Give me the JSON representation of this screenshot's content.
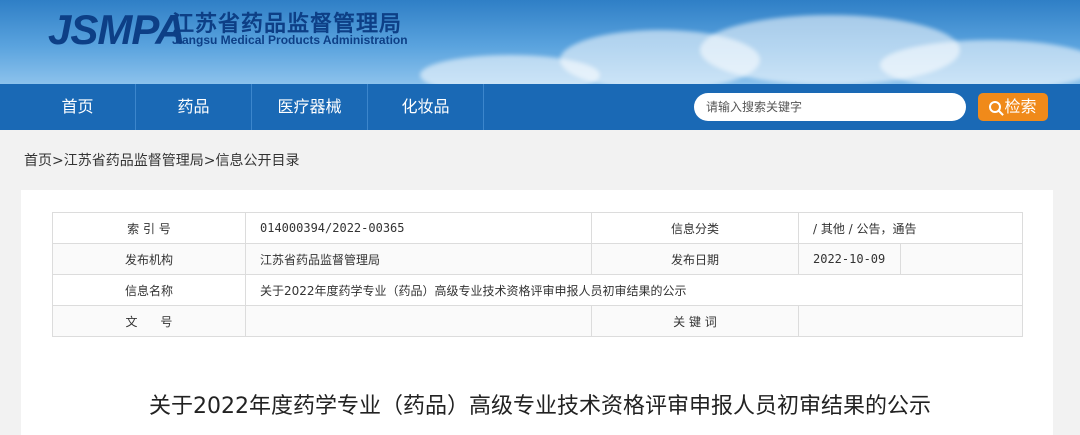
{
  "header": {
    "logo_abbr": "JSMPA",
    "logo_cn": "江苏省药品监督管理局",
    "logo_en": "Jiangsu Medical Products Administration"
  },
  "nav": {
    "items": [
      {
        "label": "首页"
      },
      {
        "label": "药品"
      },
      {
        "label": "医疗器械"
      },
      {
        "label": "化妆品"
      }
    ],
    "search_placeholder": "请输入搜索关键字",
    "search_button": "检索"
  },
  "breadcrumb": {
    "home": "首页",
    "sep1": ">",
    "org": "江苏省药品监督管理局",
    "sep2": ">",
    "current": "信息公开目录"
  },
  "meta": {
    "index_label": "索 引 号",
    "index_value": "014000394/2022-00365",
    "category_label": "信息分类",
    "category_value": "/  其他  /  公告，通告",
    "publisher_label": "发布机构",
    "publisher_value": "江苏省药品监督管理局",
    "date_label": "发布日期",
    "date_value": "2022-10-09",
    "name_label": "信息名称",
    "name_value": "关于2022年度药学专业（药品）高级专业技术资格评审申报人员初审结果的公示",
    "docno_label": "文      号",
    "docno_value": "",
    "keyword_label": "关 键 词",
    "keyword_value": ""
  },
  "article": {
    "title": "关于2022年度药学专业（药品）高级专业技术资格评审申报人员初审结果的公示"
  },
  "colors": {
    "nav_bg": "#1a69b5",
    "header_blue": "#0d3f86",
    "search_button": "#f08a1a"
  }
}
